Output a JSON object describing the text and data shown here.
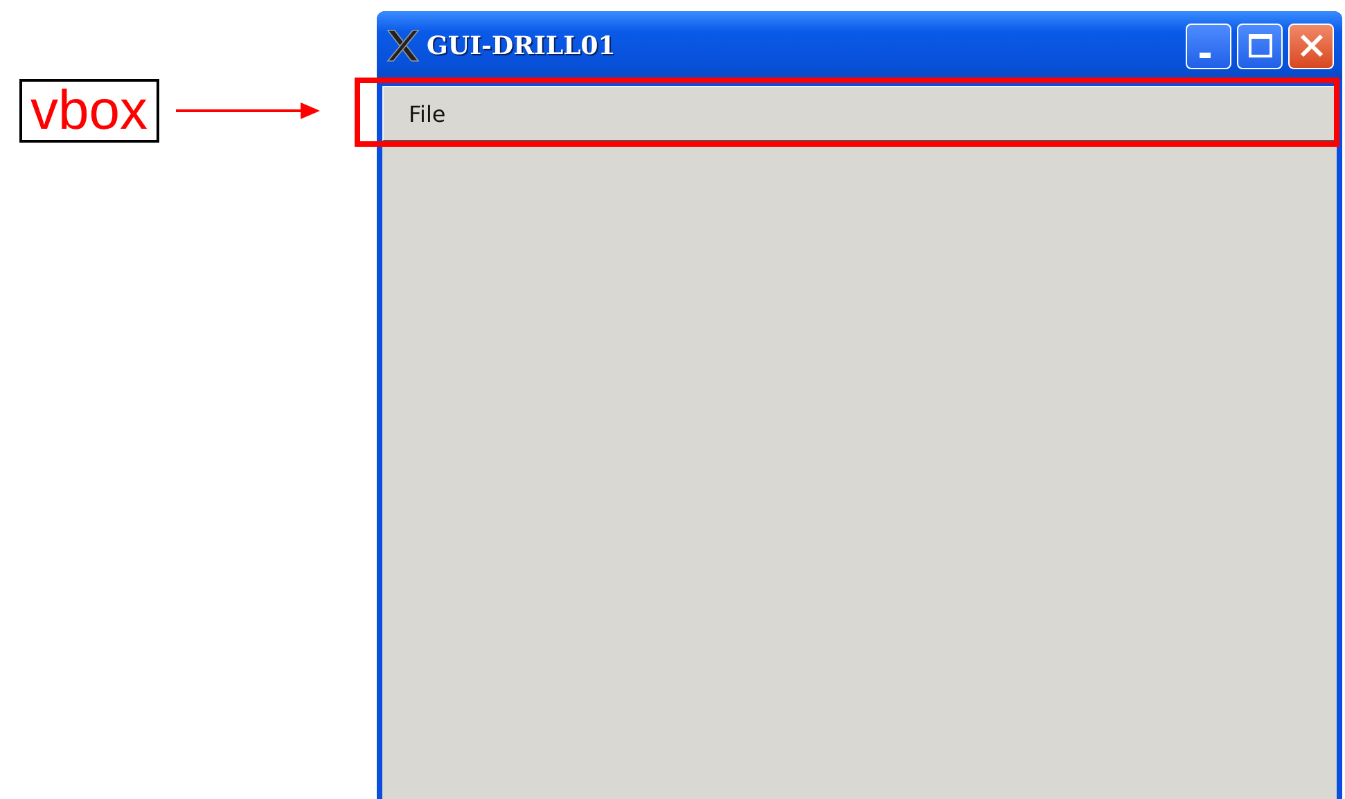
{
  "annotation": {
    "label": "vbox"
  },
  "window": {
    "title": "GUI-DRILL01"
  },
  "menu_bar": [
    {
      "label": "File"
    }
  ]
}
